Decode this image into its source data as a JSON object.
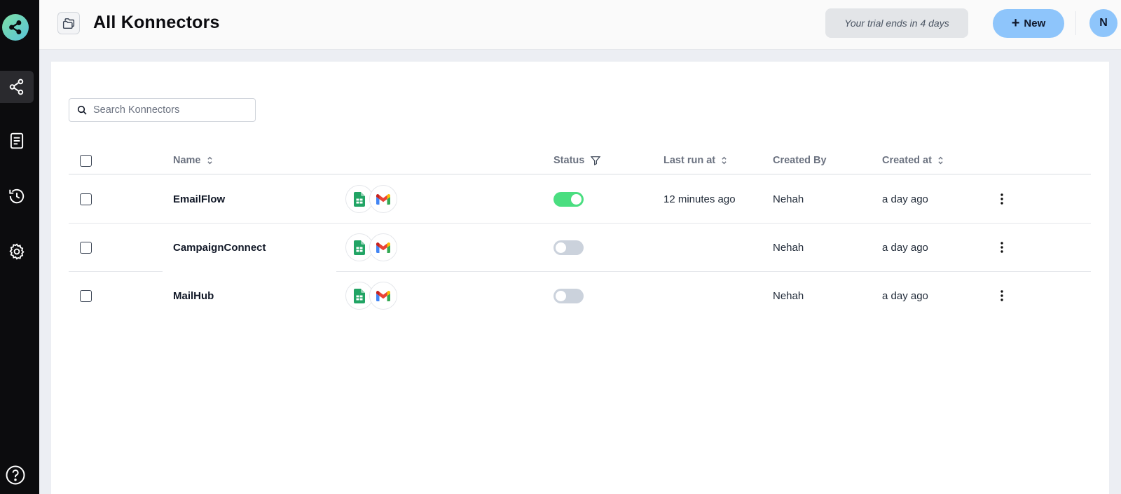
{
  "header": {
    "title": "All Konnectors",
    "trial_text": "Your trial ends in 4 days",
    "new_button_label": "New",
    "avatar_initial": "N"
  },
  "sidebar": {
    "items": [
      {
        "icon": "share-nodes-icon",
        "active": true
      },
      {
        "icon": "document-list-icon",
        "active": false
      },
      {
        "icon": "history-icon",
        "active": false
      },
      {
        "icon": "gear-icon",
        "active": false
      }
    ],
    "help_icon": "help-circle-icon"
  },
  "search": {
    "placeholder": "Search Konnectors",
    "value": ""
  },
  "table": {
    "columns": {
      "name": "Name",
      "status": "Status",
      "last_run": "Last run at",
      "created_by": "Created By",
      "created_at": "Created at"
    },
    "rows": [
      {
        "name": "EmailFlow",
        "apps": [
          "google-sheets-icon",
          "gmail-icon"
        ],
        "status_on": true,
        "last_run": "12 minutes ago",
        "created_by": "Nehah",
        "created_at": "a day ago"
      },
      {
        "name": "CampaignConnect",
        "apps": [
          "google-sheets-icon",
          "gmail-icon"
        ],
        "status_on": false,
        "last_run": "",
        "created_by": "Nehah",
        "created_at": "a day ago"
      },
      {
        "name": "MailHub",
        "apps": [
          "google-sheets-icon",
          "gmail-icon"
        ],
        "status_on": false,
        "last_run": "",
        "created_by": "Nehah",
        "created_at": "a day ago"
      }
    ]
  },
  "colors": {
    "sidebar_bg": "#0c0c0e",
    "accent": "#8ec5fb",
    "toggle_on": "#4ade80",
    "toggle_off": "#cbd2dc"
  }
}
